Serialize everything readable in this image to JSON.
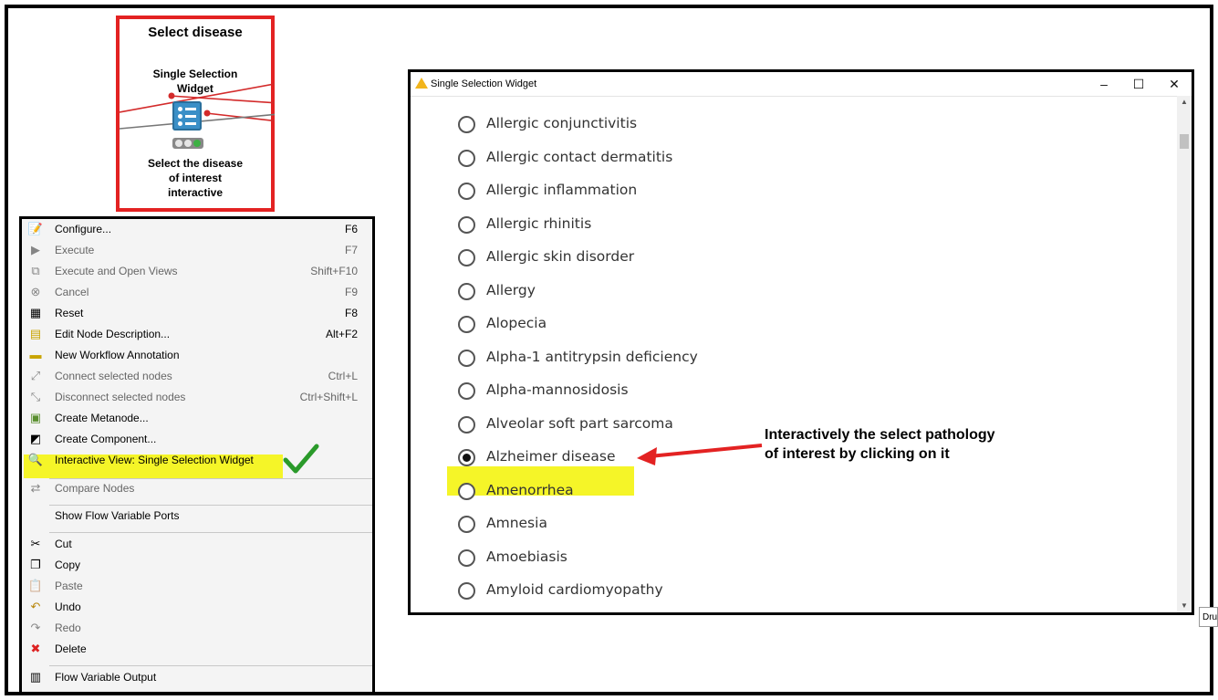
{
  "node": {
    "title": "Select disease",
    "type": "Single Selection Widget",
    "description": "Select the disease of interest interactive"
  },
  "context_menu": {
    "items": [
      {
        "label": "Configure...",
        "shortcut": "F6",
        "icon": "configure-icon",
        "disabled": false
      },
      {
        "label": "Execute",
        "shortcut": "F7",
        "icon": "execute-icon",
        "disabled": true
      },
      {
        "label": "Execute and Open Views",
        "shortcut": "Shift+F10",
        "icon": "execute-open-views-icon",
        "disabled": true
      },
      {
        "label": "Cancel",
        "shortcut": "F9",
        "icon": "cancel-icon",
        "disabled": true
      },
      {
        "label": "Reset",
        "shortcut": "F8",
        "icon": "reset-icon",
        "disabled": false
      },
      {
        "label": "Edit Node Description...",
        "shortcut": "Alt+F2",
        "icon": "edit-description-icon",
        "disabled": false
      },
      {
        "label": "New Workflow Annotation",
        "shortcut": "",
        "icon": "annotation-icon",
        "disabled": false
      },
      {
        "label": "Connect selected nodes",
        "shortcut": "Ctrl+L",
        "icon": "connect-icon",
        "disabled": true
      },
      {
        "label": "Disconnect selected nodes",
        "shortcut": "Ctrl+Shift+L",
        "icon": "disconnect-icon",
        "disabled": true
      },
      {
        "label": "Create Metanode...",
        "shortcut": "",
        "icon": "metanode-icon",
        "disabled": false
      },
      {
        "label": "Create Component...",
        "shortcut": "",
        "icon": "component-icon",
        "disabled": false
      },
      {
        "label": "Interactive View: Single Selection Widget",
        "shortcut": "",
        "icon": "magnifier-icon",
        "disabled": false
      },
      {
        "label": "Compare Nodes",
        "shortcut": "",
        "icon": "compare-icon",
        "disabled": true
      },
      {
        "label": "Show Flow Variable Ports",
        "shortcut": "",
        "icon": "",
        "disabled": false
      },
      {
        "label": "Cut",
        "shortcut": "",
        "icon": "scissors-icon",
        "disabled": false
      },
      {
        "label": "Copy",
        "shortcut": "",
        "icon": "copy-icon",
        "disabled": false
      },
      {
        "label": "Paste",
        "shortcut": "",
        "icon": "paste-icon",
        "disabled": true
      },
      {
        "label": "Undo",
        "shortcut": "",
        "icon": "undo-icon",
        "disabled": false
      },
      {
        "label": "Redo",
        "shortcut": "",
        "icon": "redo-icon",
        "disabled": true
      },
      {
        "label": "Delete",
        "shortcut": "",
        "icon": "delete-icon",
        "disabled": false
      },
      {
        "label": "Flow Variable Output",
        "shortcut": "",
        "icon": "flow-variable-icon",
        "disabled": false
      }
    ]
  },
  "widget_window": {
    "title": "Single Selection Widget",
    "minimize": "–",
    "maximize": "☐",
    "close": "✕",
    "options": [
      {
        "label": "Allergic conjunctivitis",
        "selected": false
      },
      {
        "label": "Allergic contact dermatitis",
        "selected": false
      },
      {
        "label": "Allergic inflammation",
        "selected": false
      },
      {
        "label": "Allergic rhinitis",
        "selected": false
      },
      {
        "label": "Allergic skin disorder",
        "selected": false
      },
      {
        "label": "Allergy",
        "selected": false
      },
      {
        "label": "Alopecia",
        "selected": false
      },
      {
        "label": "Alpha-1 antitrypsin deficiency",
        "selected": false
      },
      {
        "label": "Alpha-mannosidosis",
        "selected": false
      },
      {
        "label": "Alveolar soft part sarcoma",
        "selected": false
      },
      {
        "label": "Alzheimer disease",
        "selected": true
      },
      {
        "label": "Amenorrhea",
        "selected": false
      },
      {
        "label": "Amnesia",
        "selected": false
      },
      {
        "label": "Amoebiasis",
        "selected": false
      },
      {
        "label": "Amyloid cardiomyopathy",
        "selected": false
      }
    ]
  },
  "annotation": {
    "line1": "Interactively  the select pathology",
    "line2": "of  interest by clicking on it"
  },
  "side_tab": "Dru",
  "colors": {
    "node_border": "#e32222",
    "highlight": "#f5f528",
    "arrow": "#e32222",
    "check": "#2a9a2a"
  }
}
